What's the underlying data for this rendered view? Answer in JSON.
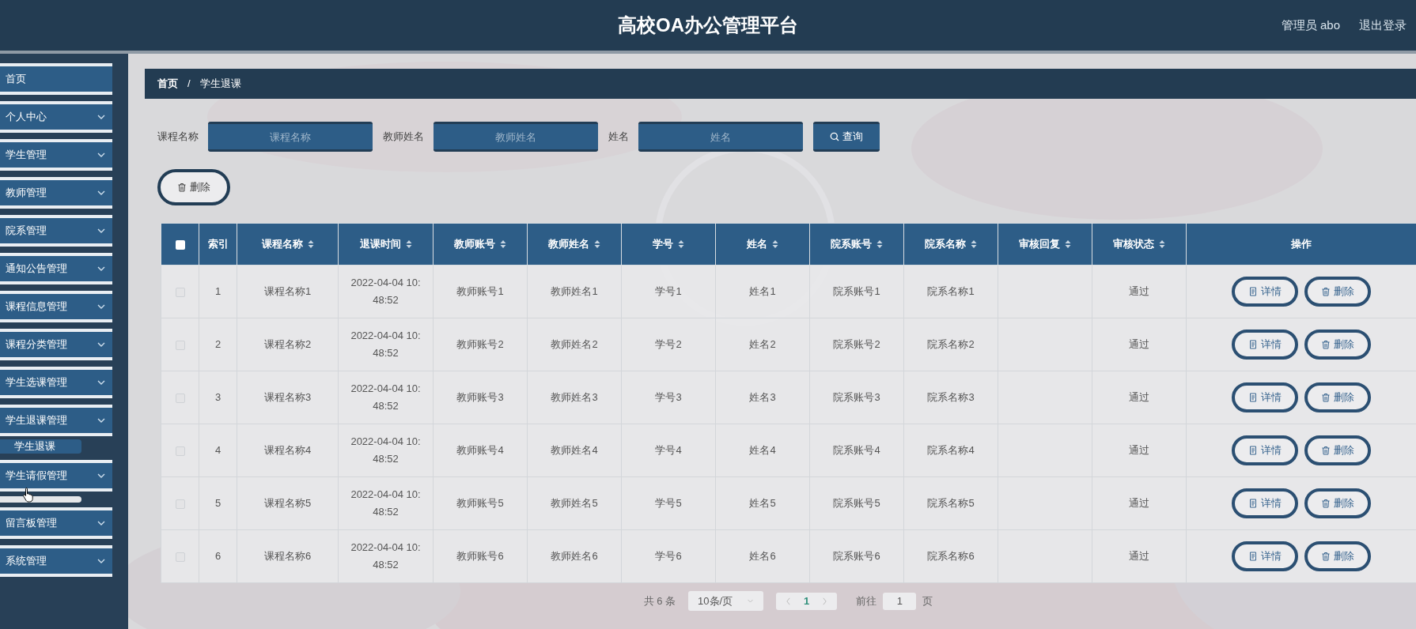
{
  "header": {
    "title": "高校OA办公管理平台",
    "user": "管理员 abo",
    "logout": "退出登录"
  },
  "sidebar": {
    "items": [
      {
        "label": "首页",
        "kind": "link"
      },
      {
        "label": "个人中心",
        "kind": "menu"
      },
      {
        "label": "学生管理",
        "kind": "menu"
      },
      {
        "label": "教师管理",
        "kind": "menu"
      },
      {
        "label": "院系管理",
        "kind": "menu"
      },
      {
        "label": "通知公告管理",
        "kind": "menu"
      },
      {
        "label": "课程信息管理",
        "kind": "menu"
      },
      {
        "label": "课程分类管理",
        "kind": "menu"
      },
      {
        "label": "学生选课管理",
        "kind": "menu"
      },
      {
        "label": "学生退课管理",
        "kind": "menu",
        "expanded": true,
        "children": [
          {
            "label": "学生退课",
            "selected": true
          }
        ]
      },
      {
        "label": "学生请假管理",
        "kind": "menu"
      },
      {
        "label": "留言板管理",
        "kind": "menu"
      },
      {
        "label": "系统管理",
        "kind": "menu"
      }
    ]
  },
  "breadcrumb": [
    "首页",
    "/",
    "学生退课"
  ],
  "search": {
    "fields": [
      {
        "label": "课程名称",
        "placeholder": "课程名称"
      },
      {
        "label": "教师姓名",
        "placeholder": "教师姓名"
      },
      {
        "label": "姓名",
        "placeholder": "姓名"
      }
    ],
    "button": "查询"
  },
  "delete_button": "删除",
  "table": {
    "select_all": {
      "checked": false
    },
    "columns": [
      {
        "label": "索引",
        "sortable": false
      },
      {
        "label": "课程名称",
        "sortable": true
      },
      {
        "label": "退课时间",
        "sortable": true
      },
      {
        "label": "教师账号",
        "sortable": true
      },
      {
        "label": "教师姓名",
        "sortable": true
      },
      {
        "label": "学号",
        "sortable": true
      },
      {
        "label": "姓名",
        "sortable": true
      },
      {
        "label": "院系账号",
        "sortable": true
      },
      {
        "label": "院系名称",
        "sortable": true
      },
      {
        "label": "审核回复",
        "sortable": true
      },
      {
        "label": "审核状态",
        "sortable": true
      },
      {
        "label": "操作",
        "sortable": false
      }
    ],
    "rows": [
      {
        "selected": false,
        "cells": [
          "1",
          "课程名称1",
          "2022-04-04 10:48:52",
          "教师账号1",
          "教师姓名1",
          "学号1",
          "姓名1",
          "院系账号1",
          "院系名称1",
          "",
          "通过"
        ],
        "actions": [
          "详情",
          "删除"
        ]
      },
      {
        "selected": false,
        "cells": [
          "2",
          "课程名称2",
          "2022-04-04 10:48:52",
          "教师账号2",
          "教师姓名2",
          "学号2",
          "姓名2",
          "院系账号2",
          "院系名称2",
          "",
          "通过"
        ],
        "actions": [
          "详情",
          "删除"
        ]
      },
      {
        "selected": false,
        "cells": [
          "3",
          "课程名称3",
          "2022-04-04 10:48:52",
          "教师账号3",
          "教师姓名3",
          "学号3",
          "姓名3",
          "院系账号3",
          "院系名称3",
          "",
          "通过"
        ],
        "actions": [
          "详情",
          "删除"
        ]
      },
      {
        "selected": false,
        "cells": [
          "4",
          "课程名称4",
          "2022-04-04 10:48:52",
          "教师账号4",
          "教师姓名4",
          "学号4",
          "姓名4",
          "院系账号4",
          "院系名称4",
          "",
          "通过"
        ],
        "actions": [
          "详情",
          "删除"
        ]
      },
      {
        "selected": false,
        "cells": [
          "5",
          "课程名称5",
          "2022-04-04 10:48:52",
          "教师账号5",
          "教师姓名5",
          "学号5",
          "姓名5",
          "院系账号5",
          "院系名称5",
          "",
          "通过"
        ],
        "actions": [
          "详情",
          "删除"
        ]
      },
      {
        "selected": false,
        "cells": [
          "6",
          "课程名称6",
          "2022-04-04 10:48:52",
          "教师账号6",
          "教师姓名6",
          "学号6",
          "姓名6",
          "院系账号6",
          "院系名称6",
          "",
          "通过"
        ],
        "actions": [
          "详情",
          "删除"
        ]
      }
    ]
  },
  "pagination": {
    "total": "共 6 条",
    "page_size": "10条/页",
    "pages": [
      {
        "label": "1",
        "selected": true
      }
    ],
    "goto": "前往",
    "goto_value": "1",
    "page_unit": "页"
  }
}
